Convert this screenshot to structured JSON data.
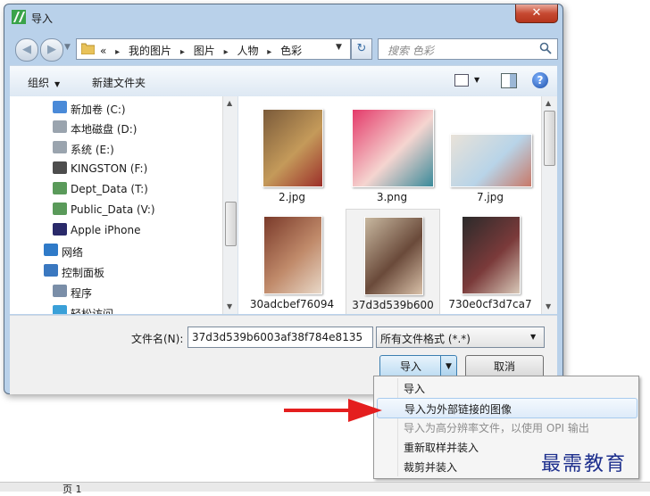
{
  "window": {
    "title": "导入",
    "close_glyph": "✕"
  },
  "nav": {
    "back_glyph": "◀",
    "forward_glyph": "▶",
    "history_glyph": "▼",
    "refresh_glyph": "↻"
  },
  "address": {
    "prefix": "«",
    "crumbs": [
      "我的图片",
      "图片",
      "人物",
      "色彩"
    ],
    "separator": "▸",
    "dropdown_glyph": "▼"
  },
  "search": {
    "placeholder": "搜索 色彩"
  },
  "toolbar": {
    "organize": "组织",
    "organize_caret": "▼",
    "new_folder": "新建文件夹",
    "view_caret": "▼",
    "help": "?"
  },
  "nav_items": [
    {
      "label": "新加卷 (C:)",
      "icon": "windows-drive-icon",
      "indent": 1
    },
    {
      "label": "本地磁盘 (D:)",
      "icon": "drive-icon",
      "indent": 1
    },
    {
      "label": "系统 (E:)",
      "icon": "drive-icon",
      "indent": 1
    },
    {
      "label": "KINGSTON (F:)",
      "icon": "usb-drive-icon",
      "indent": 1
    },
    {
      "label": "Dept_Data (T:)",
      "icon": "network-drive-icon",
      "indent": 1
    },
    {
      "label": "Public_Data (V:)",
      "icon": "network-drive-icon",
      "indent": 1
    },
    {
      "label": "Apple iPhone",
      "icon": "phone-icon",
      "indent": 1
    },
    {
      "label": "网络",
      "icon": "network-icon",
      "indent": 0
    },
    {
      "label": "控制面板",
      "icon": "control-panel-icon",
      "indent": 0
    },
    {
      "label": "程序",
      "icon": "programs-icon",
      "indent": 1
    },
    {
      "label": "轻松访问",
      "icon": "accessibility-icon",
      "indent": 1
    }
  ],
  "files": [
    {
      "name": "2.jpg",
      "colors": [
        "#7a5a3a",
        "#c49a5a",
        "#9c2f2a"
      ],
      "selected": false
    },
    {
      "name": "3.png",
      "colors": [
        "#e43a6a",
        "#f5d5d0",
        "#3a8a9a"
      ],
      "selected": false
    },
    {
      "name": "7.jpg",
      "colors": [
        "#e9e2d8",
        "#b8d4e8",
        "#c87868"
      ],
      "selected": false
    },
    {
      "name": "30adcbef76094",
      "colors": [
        "#7a3a2a",
        "#c08a6a",
        "#e8d8c8"
      ],
      "selected": false
    },
    {
      "name": "37d3d539b600",
      "colors": [
        "#c8b8a0",
        "#6a4a3a",
        "#d8c0a8"
      ],
      "selected": true
    },
    {
      "name": "730e0cf3d7ca7",
      "colors": [
        "#2a2a2a",
        "#7a3a3a",
        "#d8c8b8"
      ],
      "selected": false
    }
  ],
  "scroll": {
    "up_glyph": "▲",
    "down_glyph": "▼"
  },
  "bottom": {
    "filename_label": "文件名(N):",
    "filename_value": "37d3d539b6003af38f784e8135",
    "filter_value": "所有文件格式 (*.*)",
    "filter_caret": "▼",
    "import_label": "导入",
    "import_caret": "▼",
    "cancel_label": "取消"
  },
  "menu": [
    {
      "label": "导入",
      "state": "normal"
    },
    {
      "label": "导入为外部链接的图像",
      "state": "highlight"
    },
    {
      "label": "导入为高分辨率文件，以使用 OPI 输出",
      "state": "disabled"
    },
    {
      "label": "重新取样并装入",
      "state": "normal"
    },
    {
      "label": "裁剪并装入",
      "state": "normal"
    }
  ],
  "watermark": "最需教育",
  "app_strip": {
    "page_tab": "页 1"
  },
  "colors": {
    "accent_arrow": "#e41e1e",
    "window_frame": "#b9d1ea",
    "watermark": "#1d2f8d"
  }
}
